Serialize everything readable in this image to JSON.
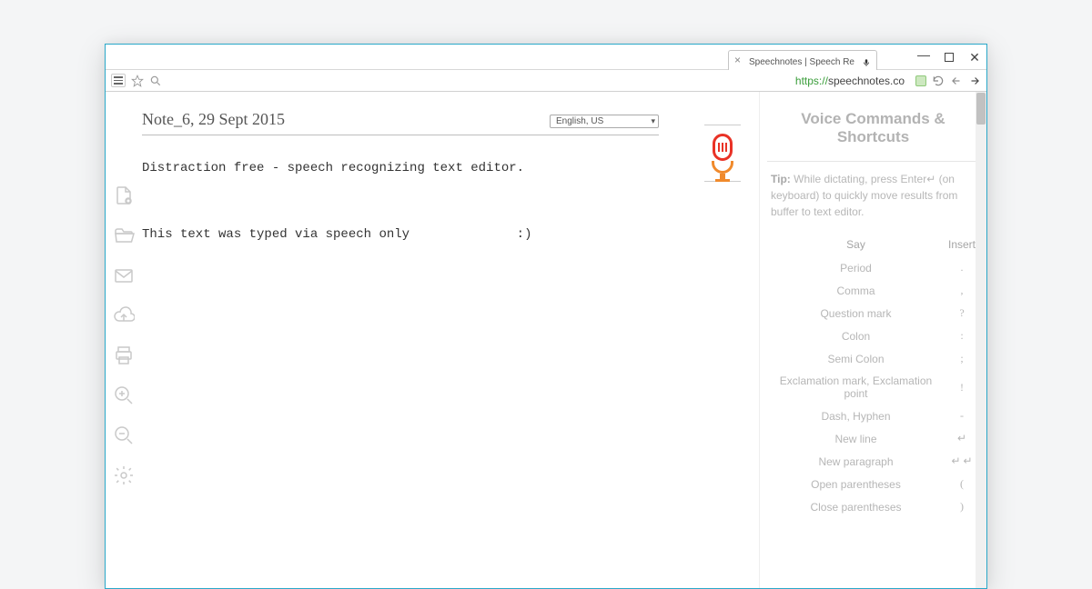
{
  "window": {
    "tab_title": "Speechnotes | Speech Re",
    "minimize": "—",
    "maximize": "",
    "close": "✕"
  },
  "urlbar": {
    "protocol": "https://",
    "host": "speechnotes.co"
  },
  "note": {
    "title": "Note_6, 29 Sept 2015",
    "language": "English, US",
    "line1": "Distraction free - speech recognizing text editor.",
    "line2": "This text was typed via speech only              :)"
  },
  "sidebar": {
    "title": "Voice Commands & Shortcuts",
    "tip_label": "Tip:",
    "tip_text": "While dictating, press Enter↵ (on keyboard) to quickly move results from buffer to text editor.",
    "headers": {
      "say": "Say",
      "insert": "Insert"
    },
    "commands": [
      {
        "say": "Period",
        "insert": "."
      },
      {
        "say": "Comma",
        "insert": ","
      },
      {
        "say": "Question mark",
        "insert": "?"
      },
      {
        "say": "Colon",
        "insert": ":"
      },
      {
        "say": "Semi Colon",
        "insert": ";"
      },
      {
        "say": "Exclamation mark, Exclamation point",
        "insert": "!"
      },
      {
        "say": "Dash, Hyphen",
        "insert": "-"
      },
      {
        "say": "New line",
        "insert": "↵"
      },
      {
        "say": "New paragraph",
        "insert": "↵ ↵"
      },
      {
        "say": "Open parentheses",
        "insert": "("
      },
      {
        "say": "Close parentheses",
        "insert": ")"
      }
    ]
  }
}
